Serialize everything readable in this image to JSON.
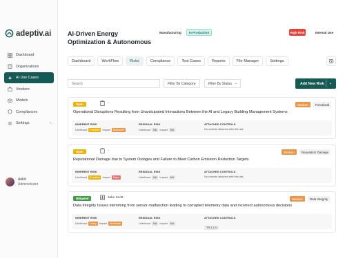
{
  "brand": {
    "name": "adeptiv.ai"
  },
  "sidebar": {
    "items": [
      {
        "label": "Dashboard",
        "icon": "grid-icon"
      },
      {
        "label": "Organizations",
        "icon": "building-icon"
      },
      {
        "label": "AI Use Cases",
        "icon": "sparkle-icon",
        "active": true
      },
      {
        "label": "Vendors",
        "icon": "vendor-icon"
      },
      {
        "label": "Models",
        "icon": "cube-icon"
      },
      {
        "label": "Compliances",
        "icon": "shield-icon"
      },
      {
        "label": "Settings",
        "icon": "gear-icon",
        "chevron": "›"
      }
    ],
    "user": {
      "name": "Ankit",
      "role": "Administrator"
    }
  },
  "header": {
    "title": "AI-Driven Energy Optimization & Autonomous",
    "tags": {
      "type": "Manufacturing",
      "status": "In Production",
      "risk": "High Risk",
      "scope": "Internal Use"
    }
  },
  "tabs": [
    "Dashboard",
    "WorkFlow",
    "Risks",
    "Compliance",
    "Test Cases",
    "Reports",
    "File Manager",
    "Settings"
  ],
  "active_tab": "Risks",
  "toolbar": {
    "search_placeholder": "Search",
    "filter_category": "Filter By Category",
    "filter_status": "Filter By Status",
    "add_button": "Add New Risk"
  },
  "labels": {
    "inherent": "INHERENT RISK",
    "residual": "RESIDUAL RISK",
    "controls": "ATTACHED CONTROLS",
    "likelihood": "Likelihood",
    "impact": "Impact"
  },
  "risks": [
    {
      "status": "Open",
      "owner": "-",
      "severity": "Medium",
      "category": "Functional",
      "title": "Operational Disruptions Resulting from Unanticipated Interactions Between the AI and Legacy Building Management Systems",
      "inherent_likelihood": "Possible",
      "inherent_impact": "Moderate",
      "residual_likelihood": "NA",
      "residual_impact": "NA",
      "controls": "No controls attached with this risk."
    },
    {
      "status": "Open",
      "owner": "-",
      "severity": "Medium",
      "category": "Reputation Damage",
      "title": "Reputational Damage due to System Outages and Failure to Meet Carbon Emission Reduction Targets",
      "inherent_likelihood": "Possible",
      "inherent_impact": "Major",
      "residual_likelihood": "NA",
      "residual_impact": "NA",
      "controls": "No controls attached with this risk."
    },
    {
      "status": "Mitigated",
      "owner": "Jake Scott",
      "severity": "Medium",
      "category": "Data Integrity",
      "title": "Data Integrity Issues stemming from sensor malfunction leading to corrupted telemetry data and incorrect autonomous decisions",
      "inherent_likelihood": "Likely",
      "inherent_impact": "Moderate",
      "residual_likelihood": "NA",
      "residual_impact": "NA",
      "controls": "TR-1.1.3"
    }
  ],
  "colors": {
    "brand": "#165a56",
    "high_risk": "#e0443a",
    "open": "#eab308",
    "mitigated": "#3e9a45",
    "medium": "#e8964a"
  }
}
